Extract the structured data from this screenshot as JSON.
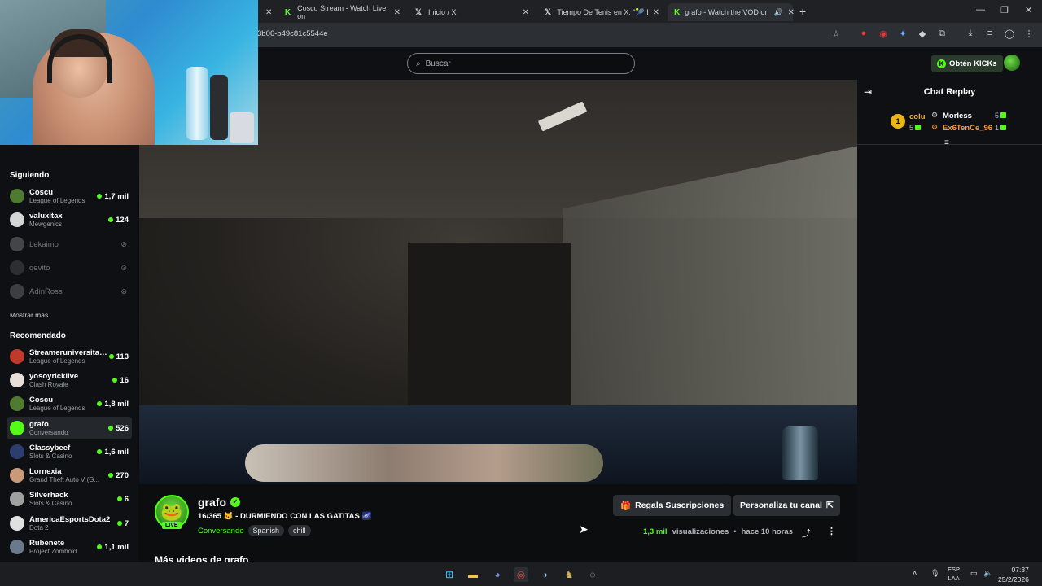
{
  "browser": {
    "tabs": [
      {
        "title": "",
        "active": false
      },
      {
        "title": "Coscu Stream - Watch Live on",
        "active": false
      },
      {
        "title": "Inicio / X",
        "active": false
      },
      {
        "title": "Tiempo De Tenis en X: \"🎾 EL E",
        "active": false
      },
      {
        "title": "grafo - Watch the VOD on",
        "active": true
      }
    ],
    "new_tab": "+",
    "url": "3b06-b49c81c5544e"
  },
  "topnav": {
    "search_placeholder": "Buscar",
    "kicks_button": "Obtén KICKs"
  },
  "sidebar": {
    "following_heading": "Siguiendo",
    "following": [
      {
        "name": "Coscu",
        "category": "League of Legends",
        "viewers": "1,7 mil",
        "live": true,
        "color": "#4f7a2f"
      },
      {
        "name": "valuxitax",
        "category": "Mewgenics",
        "viewers": "124",
        "live": true,
        "color": "#d5d5d5"
      },
      {
        "name": "Lekaimo",
        "category": "",
        "viewers": "",
        "live": false,
        "color": "#888888"
      },
      {
        "name": "qevito",
        "category": "",
        "viewers": "",
        "live": false,
        "color": "#555555"
      },
      {
        "name": "AdinRoss",
        "category": "",
        "viewers": "",
        "live": false,
        "color": "#777777"
      }
    ],
    "show_more": "Mostrar más",
    "recommended_heading": "Recomendado",
    "recommended": [
      {
        "name": "Streameruniversitario",
        "category": "League of Legends",
        "viewers": "113",
        "selected": false,
        "color": "#c0392b"
      },
      {
        "name": "yosoyricklive",
        "category": "Clash Royale",
        "viewers": "16",
        "selected": false,
        "color": "#e8e0d8"
      },
      {
        "name": "Coscu",
        "category": "League of Legends",
        "viewers": "1,8 mil",
        "selected": false,
        "color": "#4f7a2f"
      },
      {
        "name": "grafo",
        "category": "Conversando",
        "viewers": "526",
        "selected": true,
        "color": "#53fc18"
      },
      {
        "name": "Classybeef",
        "category": "Slots & Casino",
        "viewers": "1,6 mil",
        "selected": false,
        "color": "#2c3e70"
      },
      {
        "name": "Lornexia",
        "category": "Grand Theft Auto V (G...",
        "viewers": "270",
        "selected": false,
        "color": "#c89a7a"
      },
      {
        "name": "Silverhack",
        "category": "Slots & Casino",
        "viewers": "6",
        "selected": false,
        "color": "#a0a0a0"
      },
      {
        "name": "AmericaEsportsDota2",
        "category": "Dota 2",
        "viewers": "7",
        "selected": false,
        "color": "#e0e0e0"
      },
      {
        "name": "Rubenete",
        "category": "Project Zomboid",
        "viewers": "1,1 mil",
        "selected": false,
        "color": "#6a7a8a"
      }
    ]
  },
  "channel": {
    "name": "grafo",
    "live_badge": "LIVE",
    "title": "16/365 🐱 - DURMIENDO CON LAS GATITAS 🌌",
    "category": "Conversando",
    "tags": [
      "Spanish",
      "chill"
    ],
    "gift_subs_button": "Regala Suscripciones",
    "customize_button": "Personaliza tu canal",
    "views_count": "1,3 mil",
    "views_label": "visualizaciones",
    "time_ago": "hace 10 horas",
    "more_videos_heading": "Más videos de grafo"
  },
  "chat": {
    "title": "Chat Replay",
    "gifters": [
      {
        "rank": "1",
        "name": "colu",
        "count": "5",
        "color": "#e9b51a"
      },
      {
        "rank": "",
        "name": "Morless",
        "count": "5",
        "color": "#ffffff"
      },
      {
        "rank": "",
        "name": "Ex6TenCe_96",
        "count": "1",
        "color": "#ff9a3c"
      }
    ]
  },
  "taskbar": {
    "lang_top": "ESP",
    "lang_bottom": "LAA",
    "time": "07:37",
    "date": "25/2/2026"
  }
}
